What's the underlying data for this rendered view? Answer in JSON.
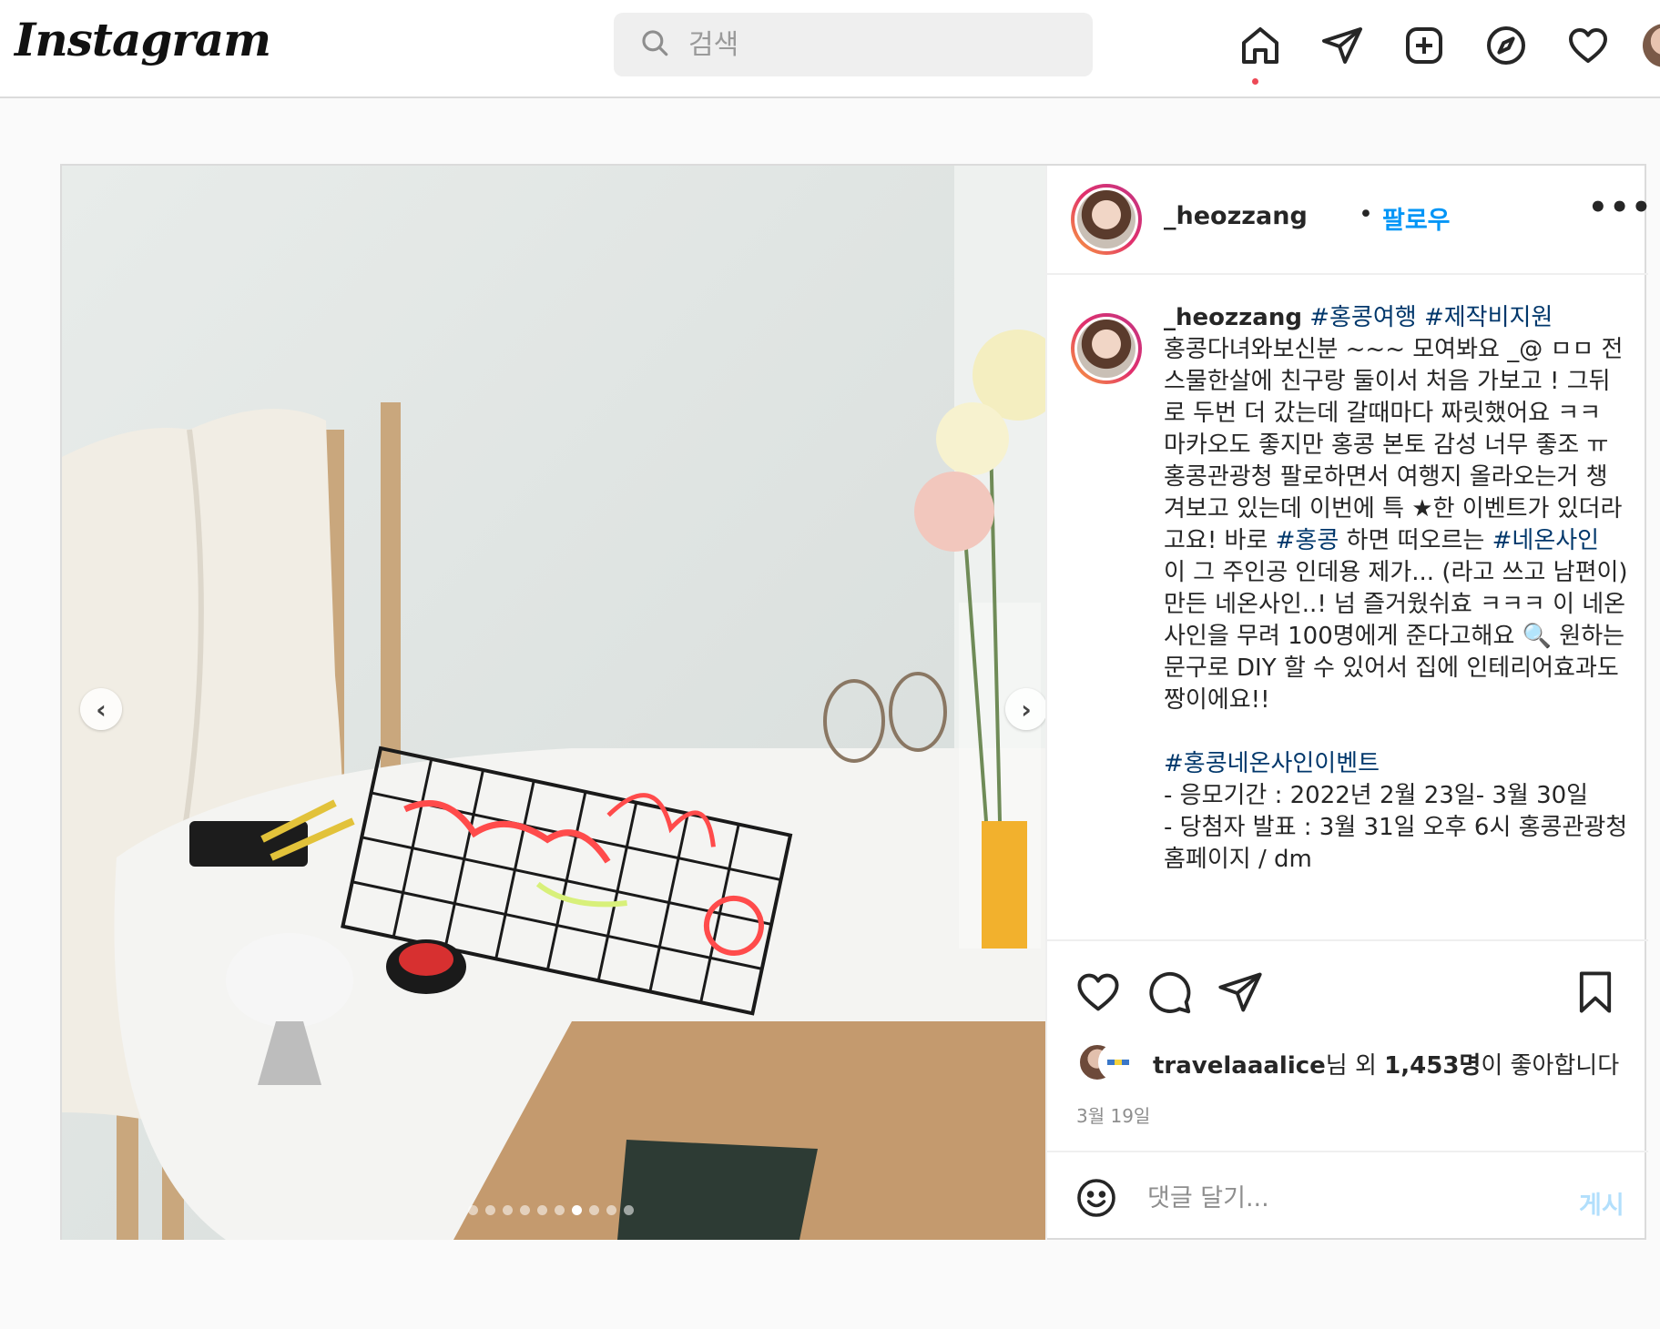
{
  "header": {
    "logo_text": "Instagram",
    "search_placeholder": "검색"
  },
  "nav": {
    "icons": [
      "home-icon",
      "direct-message-icon",
      "new-post-icon",
      "explore-icon",
      "activity-heart-icon",
      "profile-avatar"
    ],
    "active": "home-icon",
    "notification_dot_color": "#ed4956"
  },
  "post": {
    "username": "_heozzang",
    "separator": "•",
    "follow_label": "팔로우",
    "more_label": "•••",
    "caption": {
      "username": "_heozzang",
      "tags_inline_1": "#홍콩여행",
      "tags_inline_2": "#제작비지원",
      "body_1": "\n홍콩다녀와보신분 ~~~ 모여봐요 _@ ㅁㅁ 전 스물한살에 친구랑 둘이서 처음 가보고 ! 그뒤로 두번 더 갔는데 갈때마다 짜릿했어요 ㅋㅋ 마카오도 좋지만 홍콩 본토 감성 너무 좋조 ㅠ 홍콩관광청 팔로하면서 여행지 올라오는거 챙겨보고 있는데 이번에 특 ★한 이벤트가 있더라고요! 바로 ",
      "tag_hongkong": "#홍콩",
      "body_2": " 하면 떠오르는 ",
      "tag_neon": "#네온사인",
      "body_3": " 이 그 주인공 인데용 제가... (라고 쓰고 남편이) 만든 네온사인..! 넘 즐거웠쉬효 ㅋㅋㅋ 이 네온사인을 무려 100명에게 준다고해요 🔍 원하는 문구로 DIY 할 수 있어서 집에 인테리어효과도 짱이에요!!\n\n",
      "tag_event": "#홍콩네온사인이벤트",
      "body_4": "\n- 응모기간 : 2022년 2월 23일- 3월 30일\n- 당첨자 발표 : 3월 31일 오후 6시 홍콩관광청 홈페이지 / dm"
    },
    "likes": {
      "liker": "travelaaalice",
      "suffix_1": "님 외 ",
      "count": "1,453명",
      "suffix_2": "이 좋아합니다"
    },
    "date": "3월 19일",
    "comment_placeholder": "댓글 달기...",
    "post_button": "게시",
    "carousel": {
      "total": 10,
      "active_index": 6,
      "prev_label": "‹",
      "next_label": "›"
    }
  },
  "colors": {
    "link_blue": "#0095f6",
    "hashtag": "#00376b",
    "post_button_disabled": "#b2dffc",
    "border": "#dbdbdb"
  }
}
